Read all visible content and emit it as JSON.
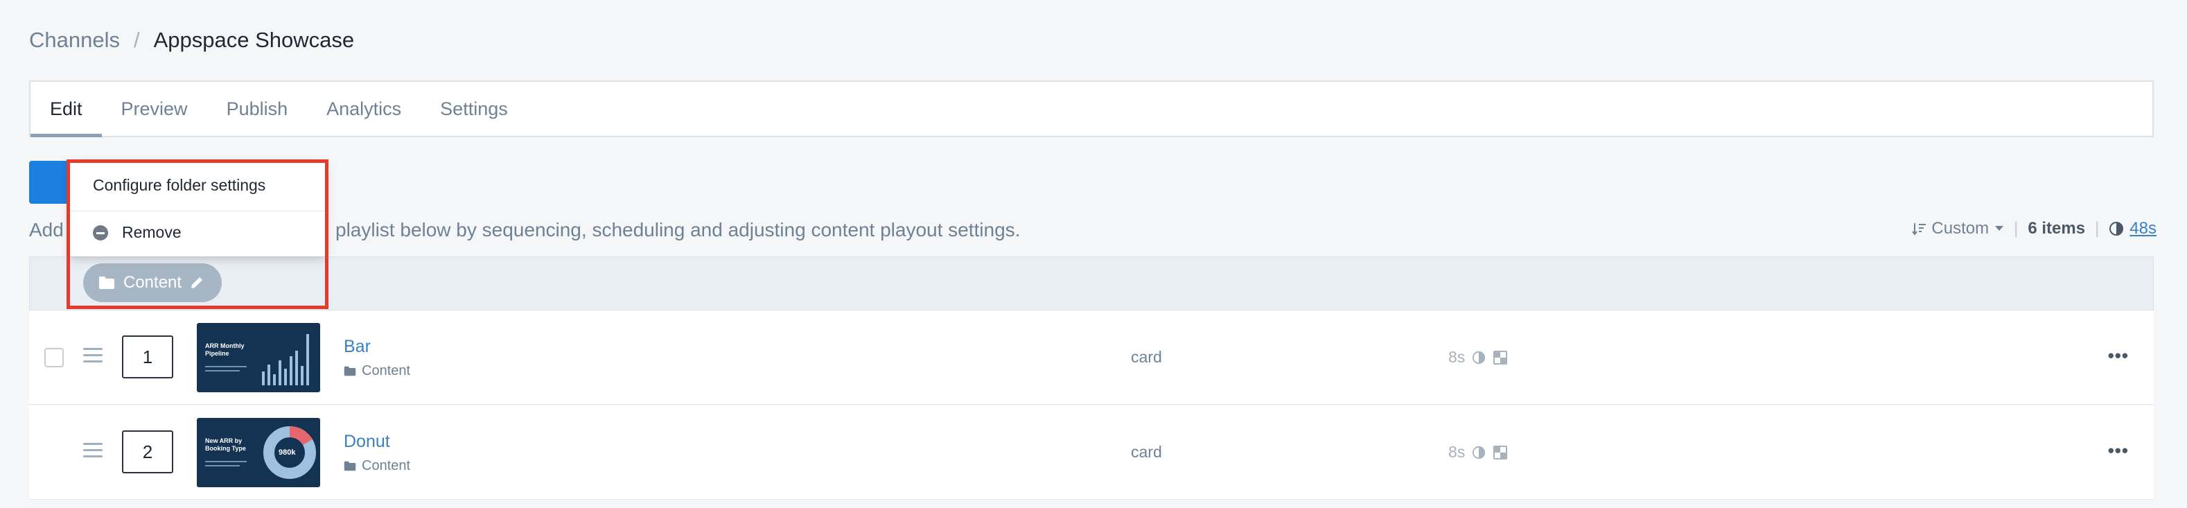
{
  "breadcrumb": {
    "parent": "Channels",
    "separator": "/",
    "current": "Appspace Showcase"
  },
  "tabs": [
    {
      "label": "Edit",
      "active": true
    },
    {
      "label": "Preview",
      "active": false
    },
    {
      "label": "Publish",
      "active": false
    },
    {
      "label": "Analytics",
      "active": false
    },
    {
      "label": "Settings",
      "active": false
    }
  ],
  "help": {
    "prefix": "Add",
    "text": "playlist below by sequencing, scheduling and adjusting content playout settings."
  },
  "toolbar": {
    "sort_label": "Custom",
    "item_count": "6 items",
    "total_duration": "48s"
  },
  "group": {
    "folder_label": "Content"
  },
  "rows": [
    {
      "position": "1",
      "name": "Bar",
      "folder": "Content",
      "type": "card",
      "duration": "8s",
      "thumb_title": "ARR Monthly Pipeline"
    },
    {
      "position": "2",
      "name": "Donut",
      "folder": "Content",
      "type": "card",
      "duration": "8s",
      "thumb_title": "New ARR by Booking Type",
      "thumb_value": "980k"
    }
  ],
  "popup": {
    "configure_label": "Configure folder settings",
    "remove_label": "Remove"
  },
  "colors": {
    "accent": "#1d7fe0",
    "link": "#3b7fc4",
    "highlight": "#e43b2c",
    "folder_pill": "#a7b6c4"
  }
}
